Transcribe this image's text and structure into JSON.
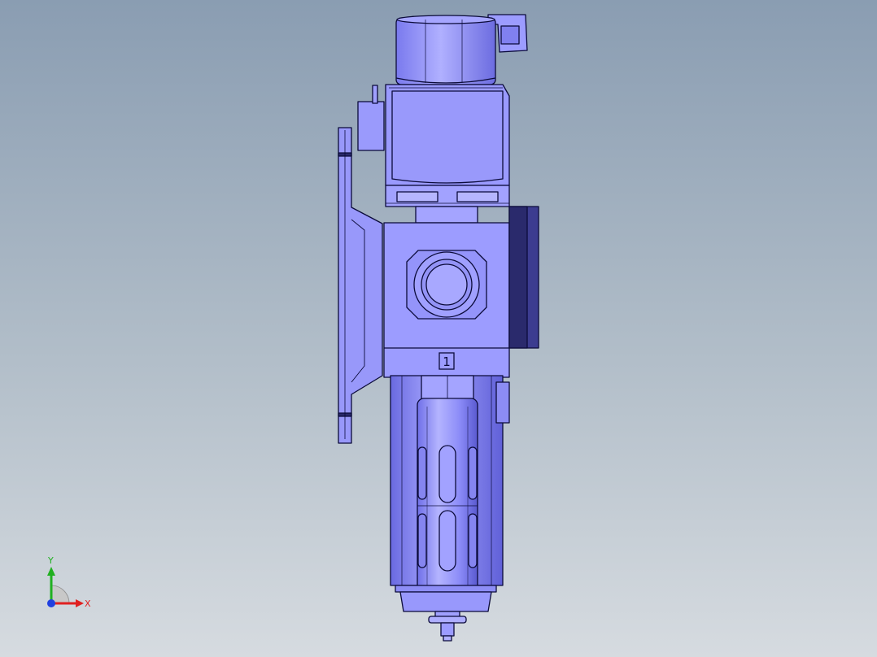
{
  "viewport": {
    "colors": {
      "background_top": "#8a9db2",
      "background_bottom": "#d6dbe0",
      "body": "#9b9bff",
      "edge": "#0b0b3a"
    }
  },
  "model": {
    "part_label": "1"
  },
  "triad": {
    "x_label": "X",
    "y_label": "Y",
    "colors": {
      "x": "#e02020",
      "y": "#20b020",
      "z": "#2040e0"
    }
  }
}
